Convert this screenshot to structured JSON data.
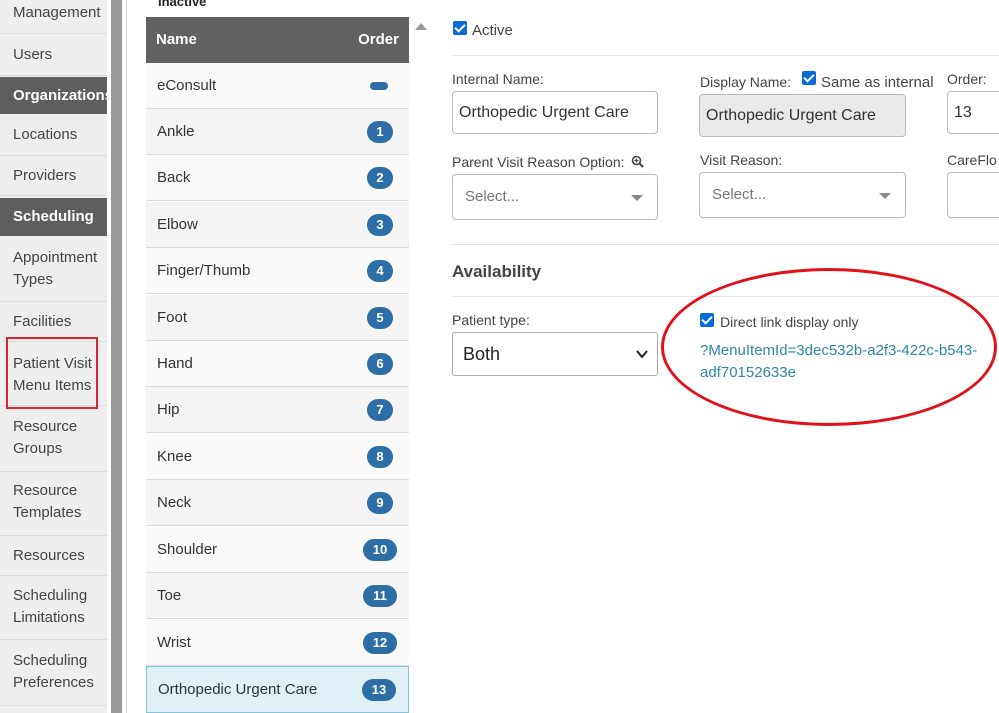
{
  "nav": {
    "items": [
      {
        "label": "Management",
        "type": "item"
      },
      {
        "label": "Users",
        "type": "item"
      },
      {
        "label": "Organizations",
        "type": "section"
      },
      {
        "label": "Locations",
        "type": "item"
      },
      {
        "label": "Providers",
        "type": "item"
      },
      {
        "label": "Scheduling",
        "type": "section"
      },
      {
        "label": "Appointment Types",
        "type": "item"
      },
      {
        "label": "Facilities",
        "type": "item"
      },
      {
        "label": "Patient Visit Menu Items",
        "type": "item",
        "highlighted": true
      },
      {
        "label": "Resource Groups",
        "type": "item"
      },
      {
        "label": "Resource Templates",
        "type": "item"
      },
      {
        "label": "Resources",
        "type": "item"
      },
      {
        "label": "Scheduling Limitations",
        "type": "item"
      },
      {
        "label": "Scheduling Preferences",
        "type": "item"
      }
    ]
  },
  "menu_list": {
    "inactive_label": "Inactive",
    "col_name": "Name",
    "col_order": "Order",
    "rows": [
      {
        "name": "eConsult",
        "order": ""
      },
      {
        "name": "Ankle",
        "order": "1"
      },
      {
        "name": "Back",
        "order": "2"
      },
      {
        "name": "Elbow",
        "order": "3"
      },
      {
        "name": "Finger/Thumb",
        "order": "4"
      },
      {
        "name": "Foot",
        "order": "5"
      },
      {
        "name": "Hand",
        "order": "6"
      },
      {
        "name": "Hip",
        "order": "7"
      },
      {
        "name": "Knee",
        "order": "8"
      },
      {
        "name": "Neck",
        "order": "9"
      },
      {
        "name": "Shoulder",
        "order": "10"
      },
      {
        "name": "Toe",
        "order": "11"
      },
      {
        "name": "Wrist",
        "order": "12"
      },
      {
        "name": "Orthopedic Urgent Care",
        "order": "13",
        "selected": true
      }
    ]
  },
  "detail": {
    "active_label": "Active",
    "internal_name_label": "Internal Name:",
    "internal_name_value": "Orthopedic Urgent Care",
    "display_name_label": "Display Name:",
    "same_as_internal_label": "Same as internal",
    "display_name_value": "Orthopedic Urgent Care",
    "order_label": "Order:",
    "order_value": "13",
    "parent_visit_reason_label": "Parent Visit Reason Option:",
    "parent_visit_reason_placeholder": "Select...",
    "visit_reason_label": "Visit Reason:",
    "visit_reason_placeholder": "Select...",
    "careflow_label": "CareFlo",
    "availability_heading": "Availability",
    "patient_type_label": "Patient type:",
    "patient_type_value": "Both",
    "direct_link_label": "Direct link display only",
    "direct_link_line1": "?MenuItemId=3dec532b-a2f3-422c-b543-",
    "direct_link_line2": "adf70152633e"
  },
  "colors": {
    "accent": "#2e6ea6",
    "highlight_red": "#e0121b",
    "link": "#2e86ab"
  }
}
